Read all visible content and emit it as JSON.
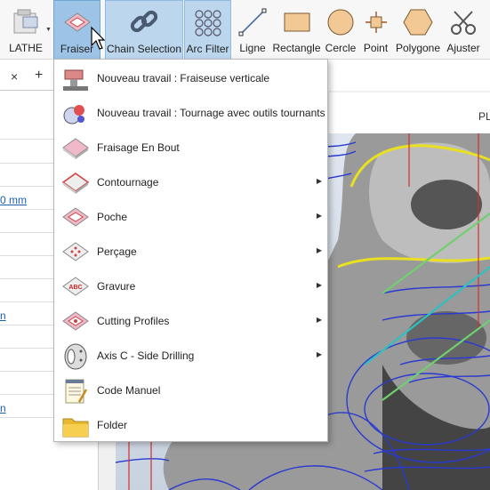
{
  "ribbon": {
    "items": [
      {
        "label": "LATHE",
        "icon": "lathe-icon"
      },
      {
        "label": "Fraiser",
        "icon": "mill-icon"
      },
      {
        "label": "Chain Selection",
        "icon": "chain-icon"
      },
      {
        "label": "Arc Filter",
        "icon": "arc-filter-icon"
      },
      {
        "label": "Ligne",
        "icon": "line-icon"
      },
      {
        "label": "Rectangle",
        "icon": "rectangle-icon"
      },
      {
        "label": "Cercle",
        "icon": "circle-icon"
      },
      {
        "label": "Point",
        "icon": "point-icon"
      },
      {
        "label": "Polygone",
        "icon": "polygon-icon"
      },
      {
        "label": "Ajuster",
        "icon": "trim-icon"
      }
    ]
  },
  "tabs": {
    "close": "×",
    "add": "+"
  },
  "left_panel": {
    "values": [
      "0 mm",
      "n",
      "n"
    ]
  },
  "view": {
    "corner_label": "PL"
  },
  "menu": {
    "items": [
      {
        "label": "Nouveau travail : Fraiseuse verticale",
        "icon": "vertical-mill-icon",
        "submenu": false
      },
      {
        "label": "Nouveau travail : Tournage avec outils tournants",
        "icon": "live-tooling-icon",
        "submenu": false
      },
      {
        "label": "Fraisage En Bout",
        "icon": "face-mill-icon",
        "submenu": false
      },
      {
        "label": "Contournage",
        "icon": "contour-icon",
        "submenu": true
      },
      {
        "label": "Poche",
        "icon": "pocket-icon",
        "submenu": true
      },
      {
        "label": "Perçage",
        "icon": "drill-icon",
        "submenu": true
      },
      {
        "label": "Gravure",
        "icon": "engrave-icon",
        "submenu": true
      },
      {
        "label": "Cutting Profiles",
        "icon": "cutting-profiles-icon",
        "submenu": true
      },
      {
        "label": "Axis C - Side Drilling",
        "icon": "side-drilling-icon",
        "submenu": true
      },
      {
        "label": "Code Manuel",
        "icon": "manual-code-icon",
        "submenu": false
      },
      {
        "label": "Folder",
        "icon": "folder-icon",
        "submenu": false
      }
    ],
    "submenu_arrow": "▶",
    "engrave_icon_text": "ABC"
  }
}
